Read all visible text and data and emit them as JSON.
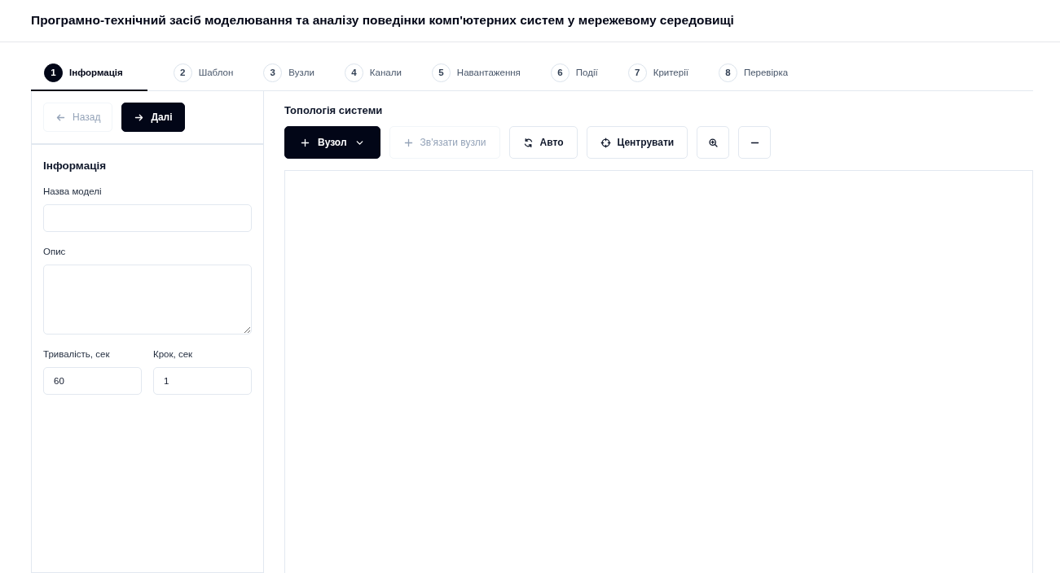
{
  "title": "Програмно-технічний засіб моделювання та аналізу поведінки комп'ютерних систем у мережевому середовищі",
  "steps": [
    {
      "number": "1",
      "label": "Інформація",
      "selected": true
    },
    {
      "number": "2",
      "label": "Шаблон",
      "selected": false
    },
    {
      "number": "3",
      "label": "Вузли",
      "selected": false
    },
    {
      "number": "4",
      "label": "Канали",
      "selected": false
    },
    {
      "number": "5",
      "label": "Навантаження",
      "selected": false
    },
    {
      "number": "6",
      "label": "Події",
      "selected": false
    },
    {
      "number": "7",
      "label": "Критерії",
      "selected": false
    },
    {
      "number": "8",
      "label": "Перевірка",
      "selected": false
    }
  ],
  "sidebar": {
    "nav_buttons": [
      {
        "label": "Назад",
        "kind": "outline",
        "disabled": true
      },
      {
        "label": "Далі",
        "kind": "primary",
        "disabled": false
      }
    ],
    "section_title": "Інформація",
    "fields": [
      {
        "label": "Назва моделі",
        "kind": "text"
      },
      {
        "label": "Опис",
        "kind": "textarea"
      },
      {
        "label": "Тривалість, сек",
        "kind": "half",
        "value": "60"
      },
      {
        "label": "Крок, сек",
        "kind": "half",
        "value": "1"
      }
    ]
  },
  "topology": {
    "title": "Топологія системи",
    "toolbar": [
      {
        "label": "Вузол",
        "kind": "primary",
        "disabled": false
      },
      {
        "label": "Зв'язати вузли",
        "kind": "outline",
        "disabled": true
      },
      {
        "label": "Авто",
        "kind": "outline",
        "disabled": false
      },
      {
        "label": "Центрувати",
        "kind": "outline",
        "disabled": false
      },
      {
        "kind": "icon",
        "disabled": false
      },
      {
        "kind": "icon",
        "disabled": false
      }
    ]
  }
}
